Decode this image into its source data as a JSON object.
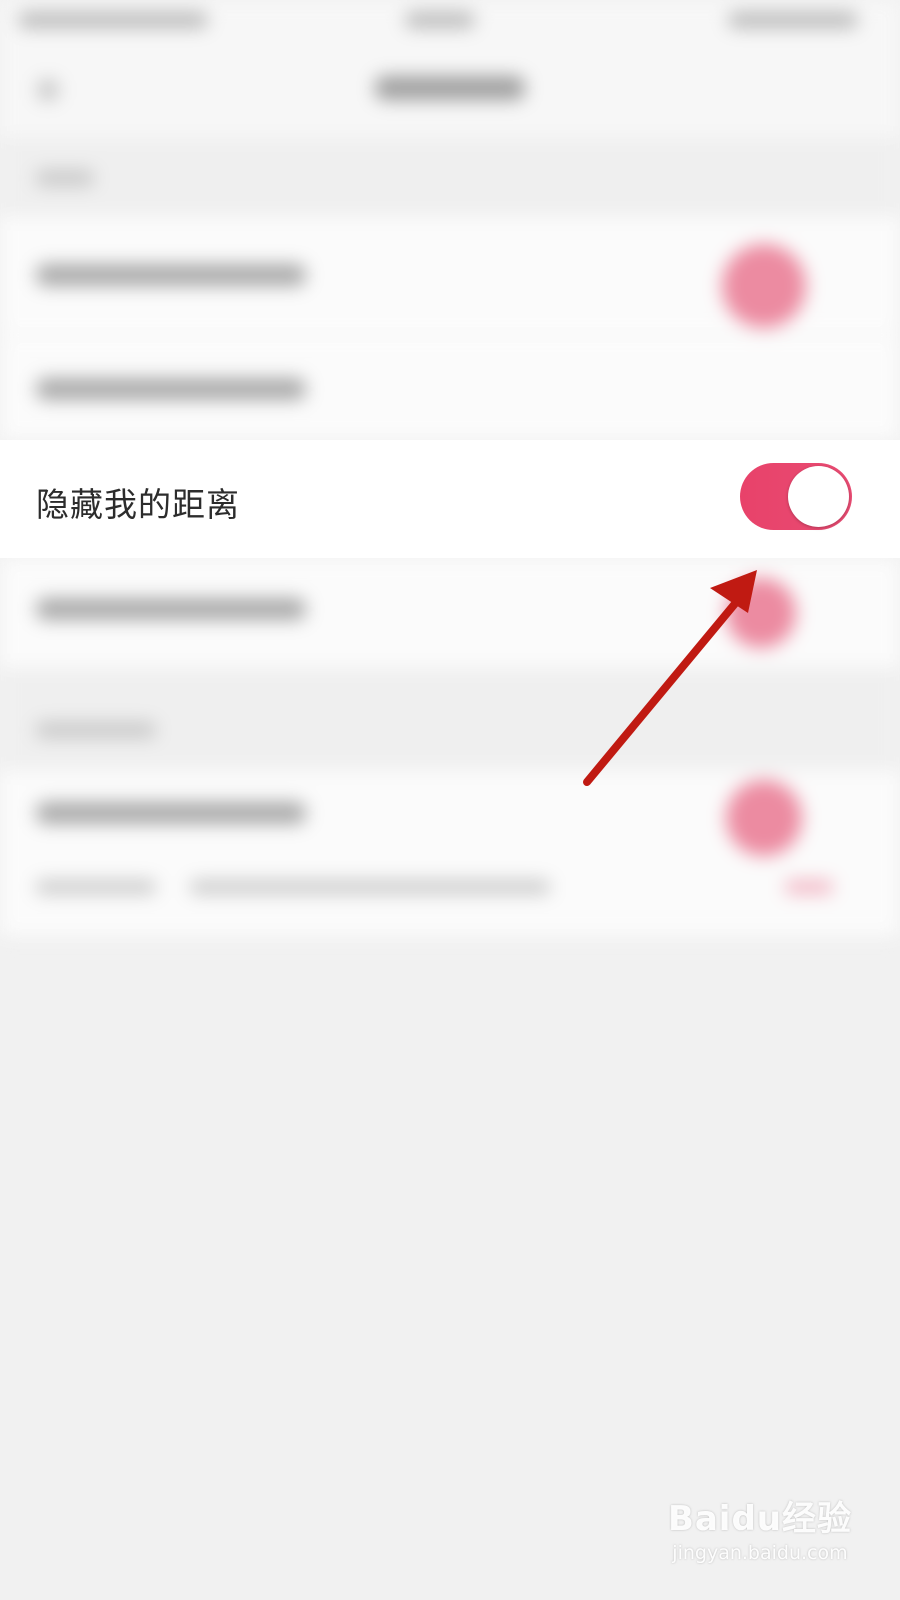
{
  "setting_row": {
    "label": "隐藏我的距离",
    "toggle_on": true
  },
  "colors": {
    "toggle_active": "#e8426a",
    "arrow": "#c01a12",
    "background": "#f1f1f1"
  },
  "watermark": {
    "logo": "Baidu经验",
    "url": "jingyan.baidu.com"
  }
}
